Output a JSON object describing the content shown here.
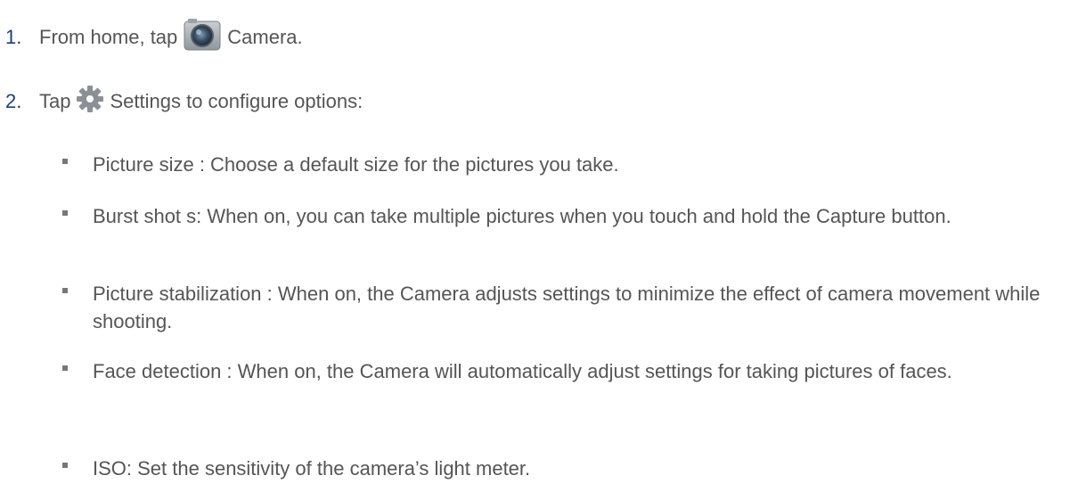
{
  "steps": [
    {
      "number": "1.",
      "before_icon": "From home, tap",
      "icon": "camera-app-icon",
      "after_icon": "Camera."
    },
    {
      "number": "2.",
      "before_icon": "Tap",
      "icon": "gear-icon",
      "after_icon": "Settings  to configure options:"
    }
  ],
  "options": [
    {
      "text": "Picture size  : Choose a default size for the pictures you take."
    },
    {
      "text": "Burst shot  s: When on, you can take multiple pictures when you touch and hold the Capture button."
    },
    {
      "text": "Picture stabilization   : When on, the Camera adjusts settings to minimize the effect of camera movement while shooting."
    },
    {
      "text": "Face detection  : When on, the Camera will automatically adjust settings for taking pictures of faces."
    },
    {
      "text": "ISO: Set the sensitivity of the camera’s light meter."
    }
  ]
}
